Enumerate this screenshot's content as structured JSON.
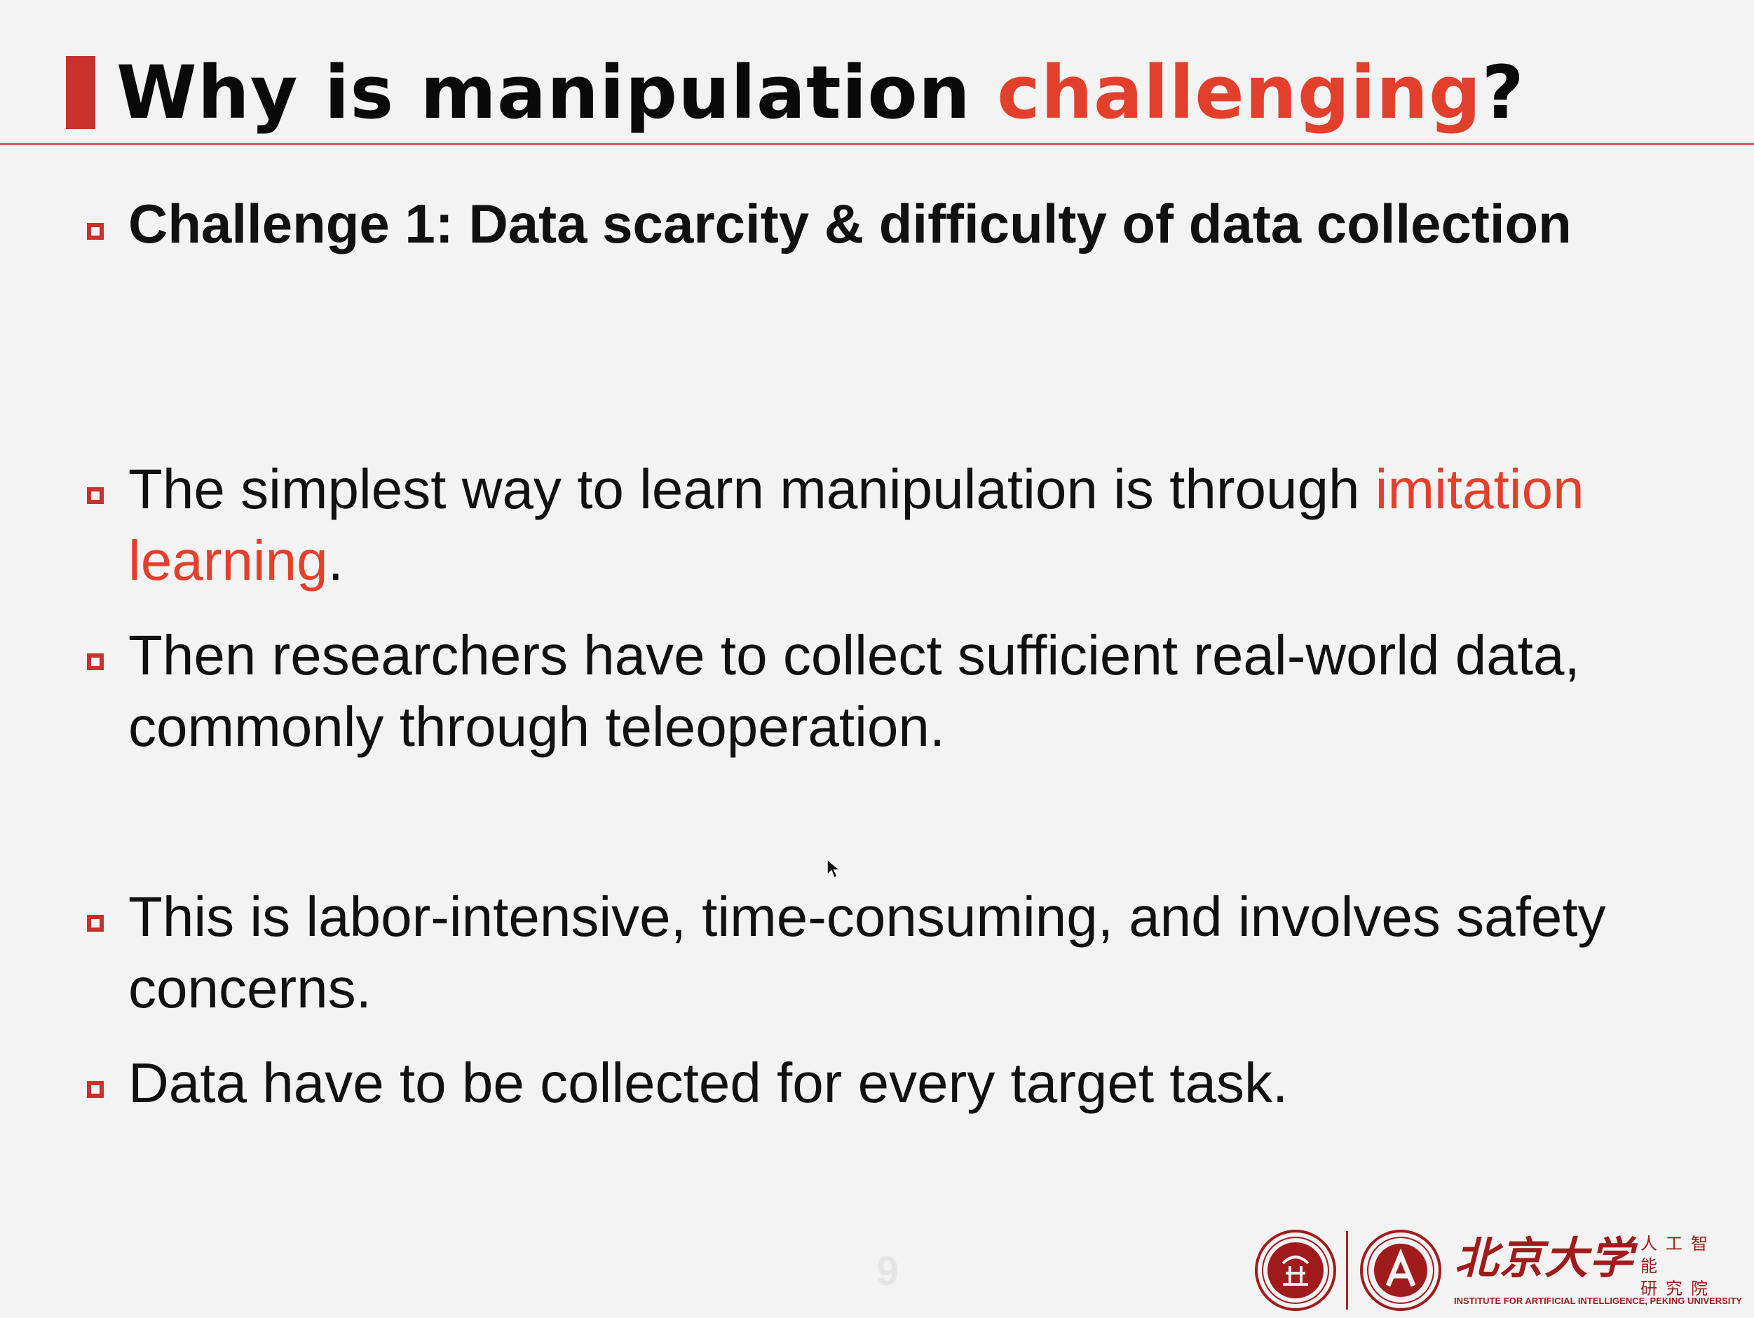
{
  "slide": {
    "title_prefix": "Why is manipulation ",
    "title_highlight": "challenging",
    "title_suffix": "?",
    "bullets": [
      {
        "text": "Challenge 1: Data scarcity & difficulty of data collection"
      },
      {
        "text_before": "The simplest way to learn manipulation is through ",
        "highlight": "imitation learning",
        "text_after": "."
      },
      {
        "text": "Then researchers have to collect sufficient real-world data, commonly through teleoperation."
      },
      {
        "text": "This is labor-intensive, time-consuming, and involves safety concerns."
      },
      {
        "text": "Data have to be collected for every target task."
      }
    ],
    "page_number": "9"
  },
  "footer": {
    "cn_name": "北京大学",
    "cn_institute_line1": "人工智能",
    "cn_institute_line2": "研究院",
    "institute_en": "INSTITUTE FOR ARTIFICIAL INTELLIGENCE, PEKING UNIVERSITY"
  },
  "colors": {
    "accent": "#e2402d",
    "accent_dark": "#c8322a",
    "brand": "#a01c1c"
  }
}
